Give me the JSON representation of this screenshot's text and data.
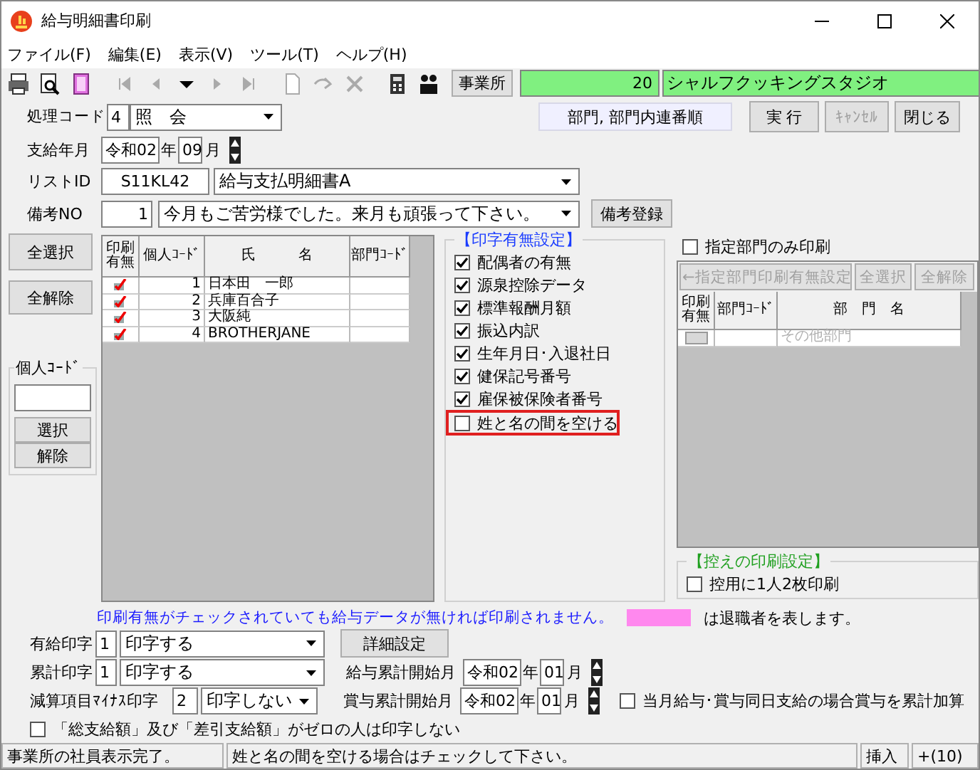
{
  "window": {
    "title": "給与明細書印刷"
  },
  "menu": [
    {
      "label": "ファイル(F)"
    },
    {
      "label": "編集(E)"
    },
    {
      "label": "表示(V)"
    },
    {
      "label": "ツール(T)"
    },
    {
      "label": "ヘルプ(H)"
    }
  ],
  "toolbar": {
    "office_button": "事業所",
    "office_code": "20",
    "office_name": "シャルフクッキングスタジオ"
  },
  "header": {
    "process": {
      "label": "処理コード",
      "code": "4",
      "value": "照　会"
    },
    "sort_order": "部門, 部門内連番順",
    "buttons": [
      {
        "label": "実 行",
        "disabled": false
      },
      {
        "label": "ｷｬﾝｾﾙ",
        "disabled": true
      },
      {
        "label": "閉じる",
        "disabled": false
      }
    ],
    "pay_month": {
      "label": "支給年月",
      "era": "令和02",
      "year_unit": "年",
      "month": "09",
      "month_unit": "月"
    },
    "list_id": {
      "label": "リストID",
      "code": "S11KL42",
      "value": "給与支払明細書A"
    },
    "remarks": {
      "label": "備考NO",
      "code": "1",
      "value": "今月もご苦労様でした。来月も頑張って下さい。",
      "button": "備考登録"
    }
  },
  "side_buttons": [
    "全選択",
    "全解除"
  ],
  "personal_code": {
    "title": "個人ｺｰﾄﾞ",
    "buttons": [
      "選択",
      "解除"
    ]
  },
  "employees": {
    "columns": [
      "印刷有無",
      "個人ｺｰﾄﾞ",
      "氏　　　名",
      "部門ｺｰﾄﾞ"
    ],
    "rows": [
      {
        "print": true,
        "code": "1",
        "name": "日本田　一郎"
      },
      {
        "print": true,
        "code": "2",
        "name": "兵庫百合子"
      },
      {
        "print": true,
        "code": "3",
        "name": "大阪純"
      },
      {
        "print": true,
        "code": "4",
        "name": "BROTHERJANE"
      }
    ]
  },
  "print_settings": {
    "title": "【印字有無設定】",
    "items": [
      {
        "label": "配偶者の有無",
        "checked": true,
        "highlighted": false
      },
      {
        "label": "源泉控除データ",
        "checked": true,
        "highlighted": false
      },
      {
        "label": "標準報酬月額",
        "checked": true,
        "highlighted": false
      },
      {
        "label": "振込内訳",
        "checked": true,
        "highlighted": false
      },
      {
        "label": "生年月日･入退社日",
        "checked": true,
        "highlighted": false
      },
      {
        "label": "健保記号番号",
        "checked": true,
        "highlighted": false
      },
      {
        "label": "雇保被保険者番号",
        "checked": true,
        "highlighted": false
      },
      {
        "label": "姓と名の間を空ける",
        "checked": false,
        "highlighted": true
      }
    ]
  },
  "departments": {
    "only_selected": {
      "label": "指定部門のみ印刷",
      "checked": false
    },
    "buttons": [
      "←指定部門印刷有無設定",
      "全選択",
      "全解除"
    ],
    "columns": [
      "印刷有無",
      "部門ｺｰﾄﾞ",
      "部　門　名"
    ],
    "rows": [
      {
        "print": false,
        "name": "その他部門"
      }
    ]
  },
  "copy_settings": {
    "title": "【控えの印刷設定】",
    "option": {
      "label": "控用に1人2枚印刷",
      "checked": false
    }
  },
  "notice": {
    "text": "印刷有無がチェックされていても給与データが無ければ印刷されません。",
    "color": "#ff88ee",
    "legend_text": "は退職者を表します。"
  },
  "bottom": {
    "paid_print": {
      "label": "有給印字",
      "code": "1",
      "value": "印字する"
    },
    "detail_button": "詳細設定",
    "cumulative_print": {
      "label": "累計印字",
      "code": "1",
      "value": "印字する"
    },
    "salary_start": {
      "label": "給与累計開始月",
      "era": "令和02",
      "year_unit": "年",
      "month": "01",
      "month_unit": "月"
    },
    "minus_print": {
      "label": "減算項目ﾏｲﾅｽ印字",
      "code": "2",
      "value": "印字しない"
    },
    "bonus_start": {
      "label": "賞与累計開始月",
      "era": "令和02",
      "year_unit": "年",
      "month": "01",
      "month_unit": "月"
    },
    "same_day_bonus": {
      "label": "当月給与･賞与同日支給の場合賞与を累計加算",
      "checked": false
    },
    "zero_skip": {
      "label": "「総支給額」及び「差引支給額」がゼロの人は印字しない",
      "checked": false
    }
  },
  "status_bar": [
    "事業所の社員表示完了。",
    "姓と名の間を空ける場合はチェックして下さい。",
    "挿入",
    "+(10)"
  ]
}
